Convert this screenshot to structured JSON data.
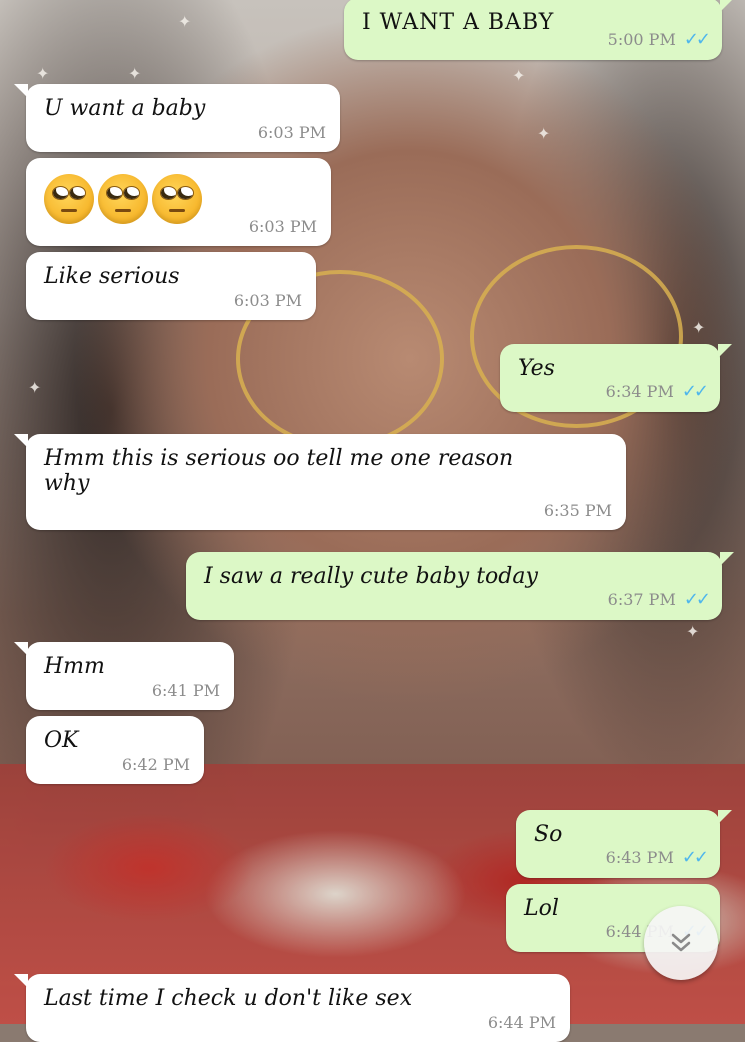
{
  "messages": [
    {
      "direction": "out",
      "text": "I WANT A BABY",
      "time": "5:00 PM",
      "status": "read"
    },
    {
      "direction": "in",
      "text": "U want a baby",
      "time": "6:03 PM"
    },
    {
      "direction": "in",
      "emoji": [
        "face-with-rolling-eyes",
        "face-with-rolling-eyes",
        "face-with-rolling-eyes"
      ],
      "time": "6:03 PM"
    },
    {
      "direction": "in",
      "text": "Like serious",
      "time": "6:03 PM"
    },
    {
      "direction": "out",
      "text": "Yes",
      "time": "6:34 PM",
      "status": "read"
    },
    {
      "direction": "in",
      "text_line1": "Hmm this is serious oo tell me one reason",
      "text_line2": "why",
      "time": "6:35 PM"
    },
    {
      "direction": "out",
      "text": "I saw a really cute baby today",
      "time": "6:37 PM",
      "status": "read"
    },
    {
      "direction": "in",
      "text": "Hmm",
      "time": "6:41 PM"
    },
    {
      "direction": "in",
      "text": "OK",
      "time": "6:42 PM"
    },
    {
      "direction": "out",
      "text": "So",
      "time": "6:43 PM",
      "status": "read"
    },
    {
      "direction": "out",
      "text": "Lol",
      "time": "6:44 PM",
      "status": "read"
    },
    {
      "direction": "in",
      "text": "Last time I check u don't like sex",
      "time": "6:44 PM"
    }
  ],
  "icons": {
    "read_receipt": "double-check-icon",
    "scroll_down": "double-chevron-down-icon"
  },
  "colors": {
    "incoming_bubble": "#ffffff",
    "outgoing_bubble": "#dcf8c6",
    "read_tick": "#4fb6ec",
    "timestamp": "#8c8c8c"
  }
}
